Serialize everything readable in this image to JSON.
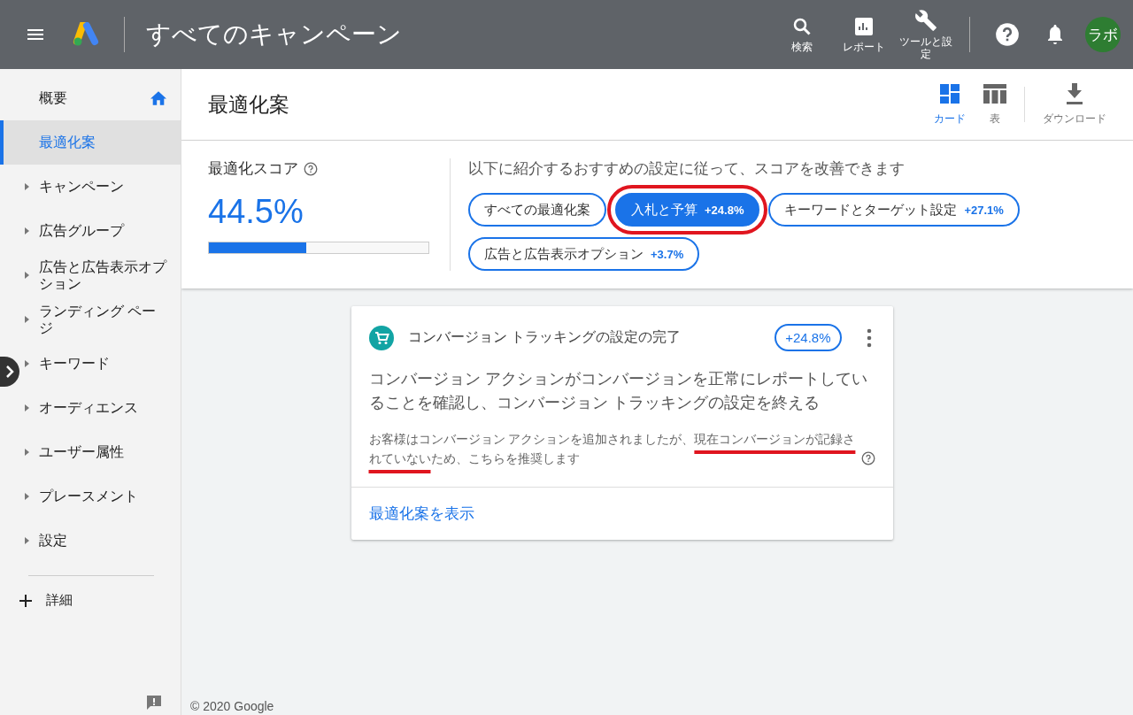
{
  "top_bar": {
    "title": "すべてのキャンペーン",
    "actions": [
      {
        "kind": "search",
        "label": "検索"
      },
      {
        "kind": "report",
        "label": "レポート"
      },
      {
        "kind": "tools",
        "label": "ツールと設定"
      }
    ],
    "account_initials": "ラボ"
  },
  "sidebar": {
    "items": [
      {
        "label": "概要",
        "selected": false,
        "expandable": false,
        "home": true
      },
      {
        "label": "最適化案",
        "selected": true,
        "expandable": false,
        "home": false
      },
      {
        "label": "キャンペーン",
        "selected": false,
        "expandable": true,
        "home": false
      },
      {
        "label": "広告グループ",
        "selected": false,
        "expandable": true,
        "home": false
      },
      {
        "label": "広告と広告表示オプション",
        "selected": false,
        "expandable": true,
        "home": false
      },
      {
        "label": "ランディング ページ",
        "selected": false,
        "expandable": true,
        "home": false
      },
      {
        "label": "キーワード",
        "selected": false,
        "expandable": true,
        "home": false
      },
      {
        "label": "オーディエンス",
        "selected": false,
        "expandable": true,
        "home": false
      },
      {
        "label": "ユーザー属性",
        "selected": false,
        "expandable": true,
        "home": false
      },
      {
        "label": "プレースメント",
        "selected": false,
        "expandable": true,
        "home": false
      },
      {
        "label": "設定",
        "selected": false,
        "expandable": true,
        "home": false
      }
    ],
    "more": "詳細"
  },
  "page": {
    "title": "最適化案",
    "views": [
      {
        "kind": "cards",
        "label": "カード",
        "selected": true
      },
      {
        "kind": "table",
        "label": "表",
        "selected": false
      }
    ],
    "download": "ダウンロード"
  },
  "score": {
    "label": "最適化スコア",
    "value": "44.5%",
    "level": 0.445
  },
  "filters": {
    "intro": "以下に紹介するおすすめの設定に従って、スコアを改善できます",
    "chips": [
      {
        "label": "すべての最適化案",
        "selected": false,
        "highlighted": false
      },
      {
        "label": "入札と予算",
        "delta": "+24.8%",
        "selected": true,
        "highlighted": true
      },
      {
        "label": "キーワードとターゲット設定",
        "delta": "+27.1%",
        "selected": false,
        "highlighted": false
      },
      {
        "label": "広告と広告表示オプション",
        "delta": "+3.7%",
        "selected": false,
        "highlighted": false
      }
    ]
  },
  "recommendation": {
    "title": "コンバージョン トラッキングの設定の完了",
    "uplift": "+24.8%",
    "headline": "コンバージョン アクションがコンバージョンを正常にレポートしていることを確認し、コンバージョン トラッキングの設定を終える",
    "reason": {
      "lead": "お客様はコンバージョン アクションを追加されましたが、",
      "underlined": "現在コンバージョンが記録されていない",
      "tail": "ため、こちらを推奨します"
    },
    "action": "最適化案を表示"
  },
  "footer": "© 2020 Google"
}
